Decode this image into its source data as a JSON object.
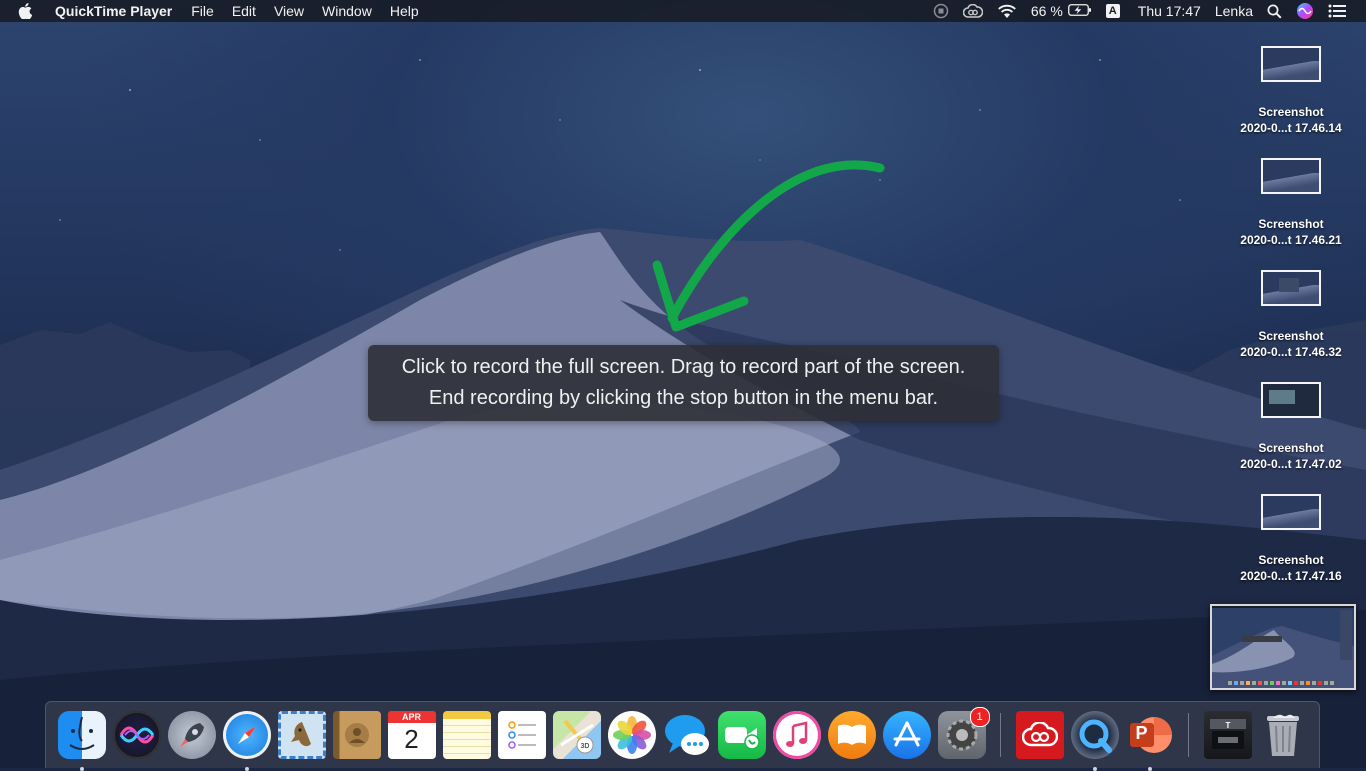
{
  "menubar": {
    "app_name": "QuickTime Player",
    "menus": [
      "File",
      "Edit",
      "View",
      "Window",
      "Help"
    ],
    "battery_percent": "66 %",
    "input_source": "A",
    "clock": "Thu 17:47",
    "user": "Lenka"
  },
  "desktop_icons": [
    {
      "line1": "Screenshot",
      "line2": "2020-0...t 17.46.14"
    },
    {
      "line1": "Screenshot",
      "line2": "2020-0...t 17.46.21"
    },
    {
      "line1": "Screenshot",
      "line2": "2020-0...t 17.46.32"
    },
    {
      "line1": "Screenshot",
      "line2": "2020-0...t 17.47.02"
    },
    {
      "line1": "Screenshot",
      "line2": "2020-0...t 17.47.16"
    }
  ],
  "hint": {
    "line1": "Click to record the full screen. Drag to record part of the screen.",
    "line2": "End recording by clicking the stop button in the menu bar."
  },
  "dock": {
    "calendar_month": "APR",
    "calendar_day": "2",
    "system_prefs_badge": "1",
    "powerpoint_letter": "P",
    "apps": [
      "finder-icon",
      "siri-icon",
      "launchpad-icon",
      "safari-icon",
      "mail-icon",
      "contacts-icon",
      "calendar-icon",
      "notes-icon",
      "reminders-icon",
      "maps-icon",
      "photos-icon",
      "messages-icon",
      "facetime-icon",
      "itunes-icon",
      "books-icon",
      "app-store-icon",
      "system-preferences-icon",
      "creative-cloud-icon",
      "quicktime-icon",
      "powerpoint-icon",
      "downloads-stack-icon",
      "trash-icon"
    ]
  },
  "colors": {
    "annotation_arrow": "#12a84a",
    "badge_red": "#e22222"
  }
}
